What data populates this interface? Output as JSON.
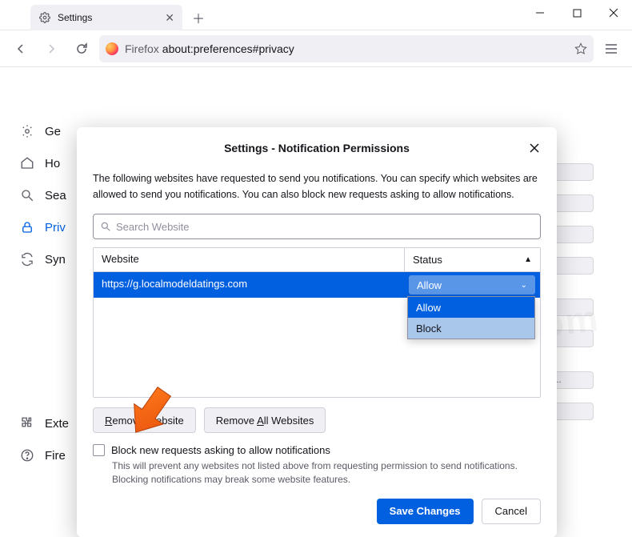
{
  "window": {
    "tab_title": "Settings",
    "url_label": "Firefox",
    "url_path": "about:preferences#privacy"
  },
  "sidebar": {
    "items": [
      {
        "label": "Ge"
      },
      {
        "label": "Ho"
      },
      {
        "label": "Sea"
      },
      {
        "label": "Priv"
      },
      {
        "label": "Syn"
      }
    ],
    "bottom": [
      {
        "label": "Exte"
      },
      {
        "label": "Fire"
      }
    ]
  },
  "stubs": [
    "...",
    "...",
    "...",
    "...",
    "...",
    "...",
    "s...",
    "..."
  ],
  "modal": {
    "title": "Settings - Notification Permissions",
    "description": "The following websites have requested to send you notifications. You can specify which websites are allowed to send you notifications. You can also block new requests asking to allow notifications.",
    "search_placeholder": "Search Website",
    "columns": {
      "website": "Website",
      "status": "Status"
    },
    "row": {
      "url": "https://g.localmodeldatings.com",
      "status": "Allow"
    },
    "dropdown": {
      "allow": "Allow",
      "block": "Block"
    },
    "remove_website": "Remove Website",
    "remove_all": "Remove All Websites",
    "block_new_label": "Block new requests asking to allow notifications",
    "block_new_hint": "This will prevent any websites not listed above from requesting permission to send notifications. Blocking notifications may break some website features.",
    "save": "Save Changes",
    "cancel": "Cancel"
  },
  "watermark": "pcrisk.com"
}
